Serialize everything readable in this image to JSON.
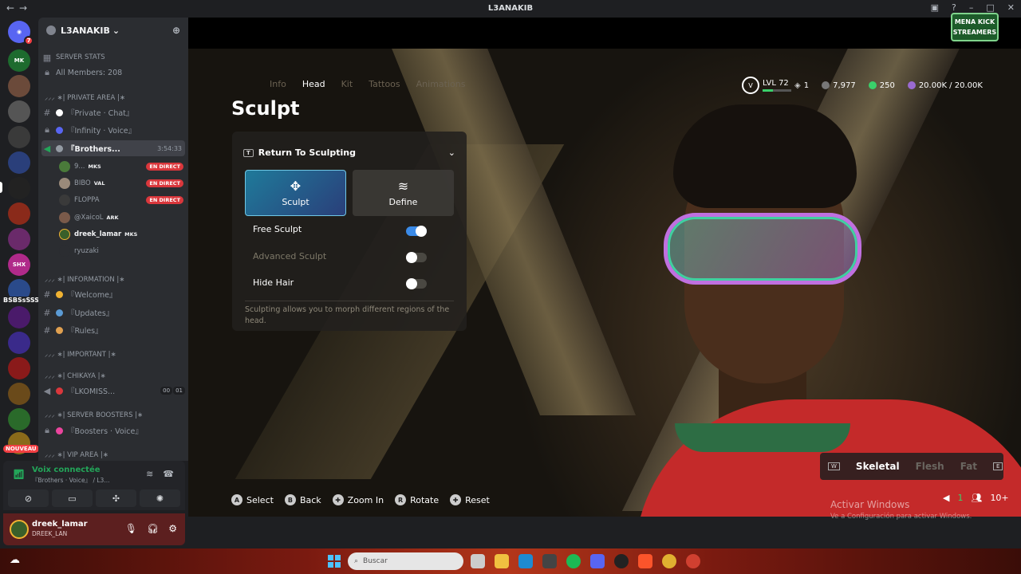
{
  "window": {
    "title": "L3ANAKIB"
  },
  "server": {
    "name": "L3ANAKIB",
    "badge_count": "7",
    "float_label": "BSBSsSSS :",
    "new_label": "NOUVEAU"
  },
  "channels": {
    "server_stats": "SERVER STATS",
    "all_members": "All Members: 208",
    "cat_private": "⸝⸝⸝ ∗| PRIVATE AREA |∗",
    "private_chat": "『Private · Chat』",
    "infinity_voice": "『Infinity · Voice』",
    "brothers": "『Brothers...",
    "brothers_timer": "3:54:33",
    "cat_information": "⸝⸝⸝ ∗| INFORMATION |∗",
    "welcome": "『Welcome』",
    "updates": "『Updates』",
    "rules": "『Rules』",
    "cat_important": "⸝⸝⸝ ∗| IMPORTANT |∗",
    "cat_chikaya": "⸝⸝⸝ ∗| CHIKAYA |∗",
    "lkomiss": "『LKOMISS...",
    "lkomiss_a": "00",
    "lkomiss_b": "01",
    "cat_boosters": "⸝⸝⸝ ∗| SERVER BOOSTERS |∗",
    "boosters_voice": "『Boosters · Voice』",
    "cat_vip": "⸝⸝⸝ ∗| VIP AREA |∗"
  },
  "voice_users": [
    {
      "name": "9...",
      "tag": "MKS",
      "live": "EN DIRECT"
    },
    {
      "name": "BIBO",
      "tag": "VAL",
      "live": "EN DIRECT"
    },
    {
      "name": "FLOPPA",
      "tag": "",
      "live": "EN DIRECT"
    },
    {
      "name": "@XaicoL",
      "tag": "ARK",
      "live": ""
    },
    {
      "name": "dreek_lamar",
      "tag": "MKS",
      "live": ""
    },
    {
      "name": "ryuzaki",
      "tag": "",
      "live": ""
    }
  ],
  "voice_panel": {
    "status": "Voix connectée",
    "channel": "『Brothers · Voice』 / L3..."
  },
  "user_panel": {
    "name": "dreek_lamar",
    "status": "DREEK_LAN"
  },
  "game": {
    "tabs": [
      "Info",
      "Head",
      "Kit",
      "Tattoos",
      "Animations"
    ],
    "active_tab": "Head",
    "title": "Sculpt",
    "panel_header": "Return To Sculpting",
    "header_key": "T",
    "card_sculpt": "Sculpt",
    "card_define": "Define",
    "opt_free": "Free Sculpt",
    "opt_advanced": "Advanced Sculpt",
    "opt_hide_hair": "Hide Hair",
    "description": "Sculpting allows you to morph different regions of the head.",
    "level": "LVL 72",
    "level_progress": 0.35,
    "rank_value": "1",
    "coins": "7,977",
    "points": "250",
    "sp": "20.00K / 20.00K",
    "layers": {
      "key_left": "W",
      "skeletal": "Skeletal",
      "flesh": "Flesh",
      "fat": "Fat",
      "key_right": "E"
    },
    "hints": [
      {
        "key": "A",
        "label": "Select"
      },
      {
        "key": "B",
        "label": "Back"
      },
      {
        "key": "✚",
        "label": "Zoom In"
      },
      {
        "key": "R",
        "label": "Rotate"
      },
      {
        "key": "✚",
        "label": "Reset"
      }
    ],
    "players_count": "1",
    "spectators": "10+"
  },
  "brand_logo": "MENA KICK STREAMERS",
  "watermark": {
    "title": "Activar Windows",
    "subtitle": "Ve a Configuración para activar Windows."
  },
  "taskbar": {
    "search_placeholder": "Buscar"
  },
  "colors": {
    "discord_green": "#23a559",
    "live_red": "#da373c",
    "accent_blue": "#3b8be8"
  }
}
